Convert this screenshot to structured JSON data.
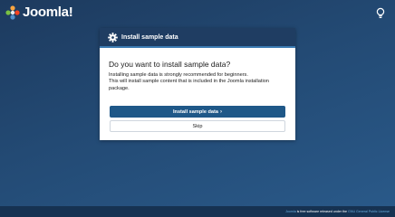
{
  "brand": {
    "name": "Joomla!"
  },
  "dialog": {
    "title": "Install sample data",
    "question": "Do you want to install sample data?",
    "description_line1": "Installing sample data is strongly recommended for beginners.",
    "description_line2": "This will install sample content that is included in the Joomla installation package.",
    "install_button": "Install sample data",
    "skip_button": "Skip"
  },
  "footer": {
    "link1": "Joomla",
    "text": "is free software released under the",
    "link2": "GNU General Public License"
  },
  "colors": {
    "header": "#1f3d62",
    "primary_button": "#1f5888",
    "footer": "#163252",
    "link": "#6aaee0"
  },
  "icons": {
    "logo": "joomla-logo-icon",
    "lightbulb": "lightbulb-icon",
    "gear": "gear-icon",
    "chevron": "chevron-right-icon"
  }
}
